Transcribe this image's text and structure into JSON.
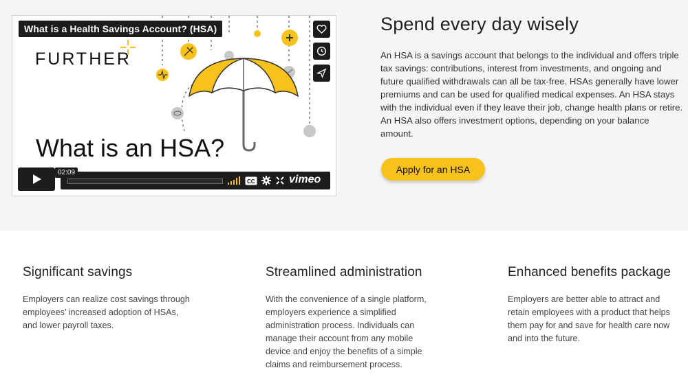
{
  "video": {
    "title": "What is a Health Savings Account? (HSA)",
    "logo_text": "FURTHER",
    "headline": "What is an HSA?",
    "time": "02:09",
    "brand": "vimeo",
    "side_buttons": [
      "heart-icon",
      "clock-icon",
      "send-icon"
    ],
    "accent_color": "#f7c21b"
  },
  "intro": {
    "heading": "Spend every day wisely",
    "body": "An HSA is a savings account that belongs to the individual and offers triple tax savings: contributions, interest from investments, and ongoing and future qualified withdrawals can all be tax-free. HSAs generally have lower premiums and can be used for qualified medical expenses.  An HSA stays with the individual even if they leave their job, change health plans or retire. An HSA also offers investment options, depending on your balance amount.",
    "cta_label": "Apply for an HSA"
  },
  "features": [
    {
      "title": "Significant savings",
      "body": "Employers can realize cost savings through employees’ increased adoption of HSAs, and lower payroll taxes."
    },
    {
      "title": "Streamlined administration",
      "body": "With the convenience of a single platform, employers experience a simplified administration process. Individuals can manage their account from any mobile device and enjoy the benefits of a simple claims and reimbursement process."
    },
    {
      "title": "Enhanced benefits package",
      "body": "Employers are better able to attract and retain employees with a product that helps them pay for and save for health care now and into the future."
    }
  ]
}
